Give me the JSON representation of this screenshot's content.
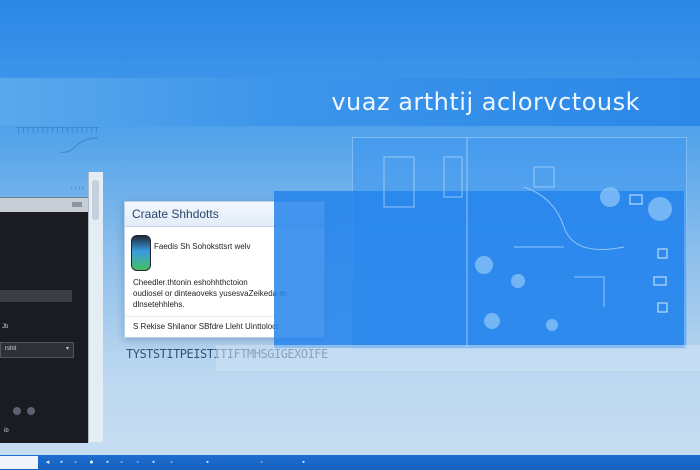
{
  "banner": {
    "title": "vuaz arthtij aclorvctousk"
  },
  "left_panel": {
    "caption": "TTTTTTTTTTTTTTTTT",
    "tiny_label": "TTTT"
  },
  "dark_app": {
    "labels": [
      "Jb",
      "ib"
    ],
    "field_value": "rshit"
  },
  "dialog": {
    "title": "Craate Shhdotts",
    "app_name": "Faedis Sh Sohoksttsrt welv",
    "description": [
      "Cheedler.thtonin eshohhthctoion",
      "oudiosel or dinteaoveks yusesvaZeikeda m",
      "dlnsetehhlehs."
    ],
    "footer": "S  Rekise Shilanor SBfdre Lleht Uinttoloct"
  },
  "garbled_text": "TYSTSTITPEISTITIFTMHSGIGEXOIFE",
  "taskbar": {
    "items": [
      "start",
      "search",
      "task-view",
      "file-explorer",
      "browser",
      "mail",
      "store",
      "settings",
      "terminal",
      "photos",
      "media"
    ]
  },
  "colors": {
    "accent": "#2b88e8",
    "panel": "#2484ec",
    "taskbar": "#1560c0"
  }
}
